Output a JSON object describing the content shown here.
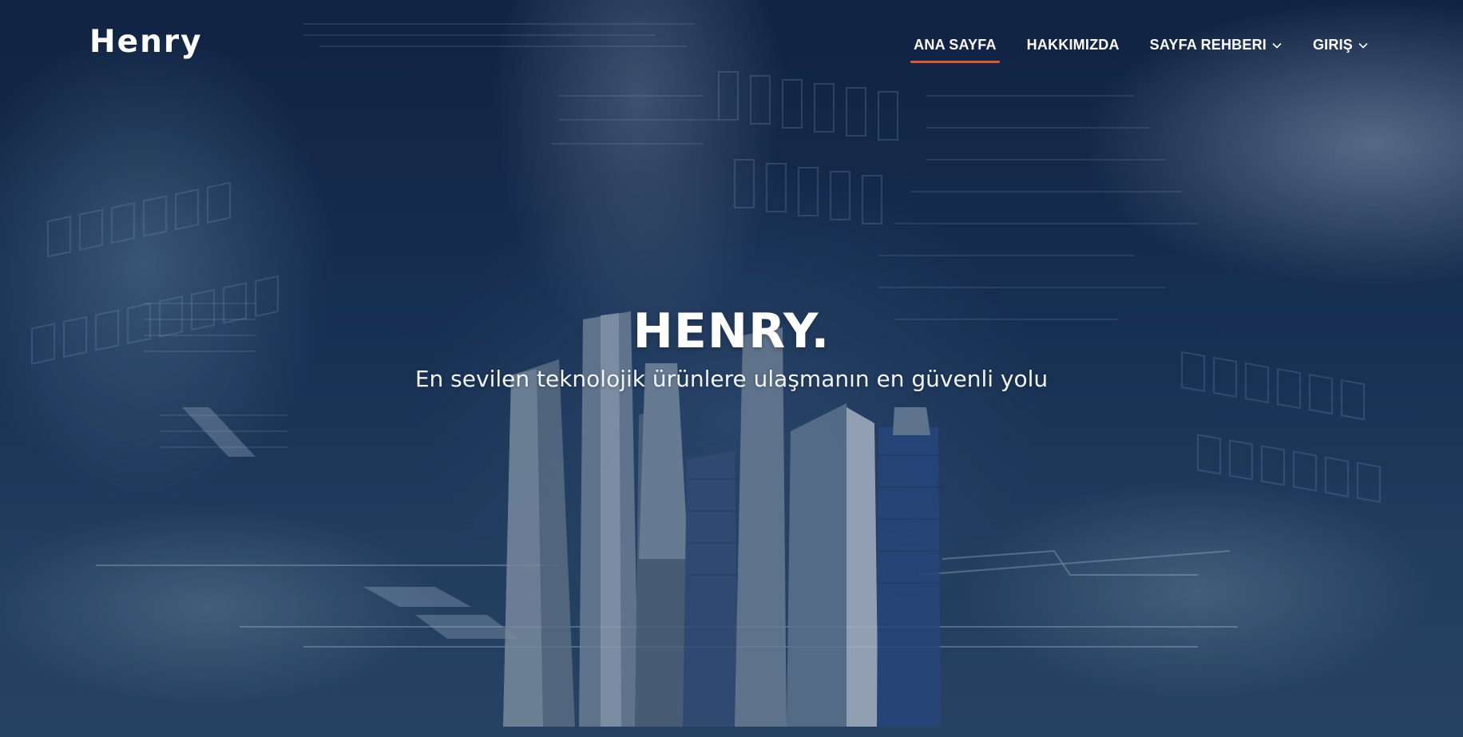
{
  "brand": {
    "logo_text": "Henry"
  },
  "nav": {
    "items": [
      {
        "label": "ANA SAYFA",
        "active": true,
        "has_dropdown": false
      },
      {
        "label": "HAKKIMIZDA",
        "active": false,
        "has_dropdown": false
      },
      {
        "label": "SAYFA REHBERI",
        "active": false,
        "has_dropdown": true
      },
      {
        "label": "GIRIŞ",
        "active": false,
        "has_dropdown": true
      }
    ],
    "active_indicator_color": "#e35a2b"
  },
  "hero": {
    "title": "HENRY.",
    "subtitle": "En sevilen teknolojik ürünlere ulaşmanın en güvenli yolu"
  },
  "icons": {
    "dropdown": "chevron-down-icon"
  },
  "colors": {
    "background": "#1a3458",
    "text": "#ffffff",
    "accent": "#e35a2b"
  }
}
